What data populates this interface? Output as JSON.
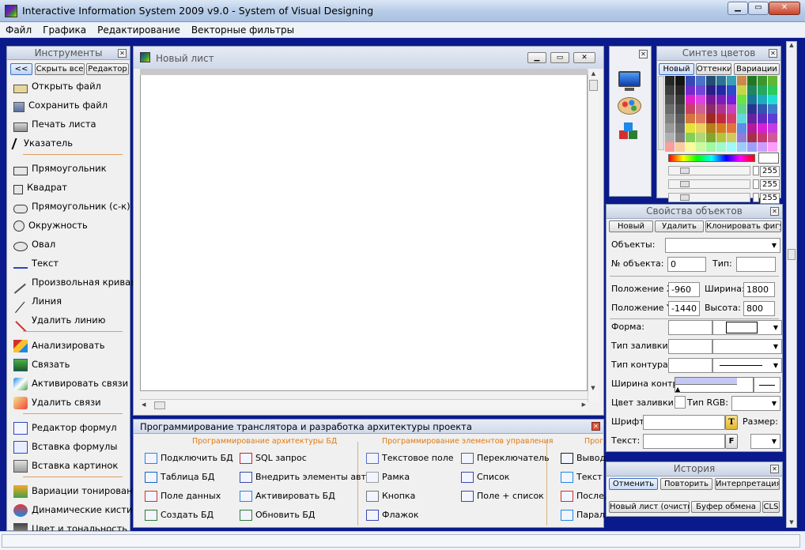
{
  "window": {
    "title": "Interactive Information System 2009 v9.0 - System of Visual Designing"
  },
  "menu": [
    "Файл",
    "Графика",
    "Редактирование",
    "Векторные фильтры"
  ],
  "tools": {
    "title": "Инструменты",
    "collapse_label": "<<",
    "hide_all_label": "Скрыть все",
    "editor_label": "Редактор",
    "items": [
      "Открыть файл",
      "Сохранить файл",
      "Печать листа",
      "Указатель",
      "Прямоугольник",
      "Квадрат",
      "Прямоугольник (с-к)",
      "Окружность",
      "Овал",
      "Текст",
      "Произвольная кривая",
      "Линия",
      "Удалить линию",
      "Анализировать",
      "Связать",
      "Активировать связи",
      "Удалить связи",
      "Редактор формул",
      "Вставка формулы",
      "Вставка картинок",
      "Вариации тонирования",
      "Динамические кисти",
      "Цвет и тональность"
    ],
    "icons": [
      "open-folder-icon",
      "save-icon",
      "print-icon",
      "pointer-icon",
      "rectangle-icon",
      "square-icon",
      "rounded-rectangle-icon",
      "circle-icon",
      "oval-icon",
      "text-icon",
      "freehand-curve-icon",
      "line-icon",
      "delete-line-icon",
      "analyze-icon",
      "link-icon",
      "activate-links-icon",
      "delete-links-icon",
      "formula-editor-icon",
      "insert-formula-icon",
      "insert-picture-icon",
      "tone-variations-icon",
      "dynamic-brushes-icon",
      "color-tone-icon"
    ]
  },
  "canvas": {
    "title": "Новый лист"
  },
  "bottom_panel": {
    "title": "Программирование транслятора и разработка архитектуры проекта",
    "group1": "Программирование архитектуры БД",
    "group2": "Программирование элементов управления",
    "group3": "Прог",
    "col1": [
      "Подключить БД",
      "Таблица БД",
      "Поле данных",
      "Создать БД"
    ],
    "col2": [
      "SQL запрос",
      "Внедрить элементы авт.",
      "Активировать БД",
      "Обновить БД"
    ],
    "col3": [
      "Текстовое поле",
      "Рамка",
      "Кнопка",
      "Флажок"
    ],
    "col4": [
      "Переключатель",
      "Список",
      "Поле + список"
    ],
    "col5": [
      "Вывод",
      "Текст л",
      "Послед",
      "Парал"
    ]
  },
  "color_synth": {
    "title": "Синтез цветов",
    "tabs": [
      "Новый",
      "Оттенки",
      "Вариации"
    ],
    "rgb_values": [
      "255",
      "255",
      "255"
    ]
  },
  "properties": {
    "title": "Свойства объектов",
    "new_label": "Новый",
    "delete_label": "Удалить",
    "clone_label": "Клонировать фигуру",
    "objects_label": "Объекты:",
    "obj_num_label": "№ объекта:",
    "obj_num_value": "0",
    "type_label": "Тип:",
    "posx_label": "Положение X:",
    "posx_value": "-960",
    "width_label": "Ширина:",
    "width_value": "1800",
    "posy_label": "Положение Y:",
    "posy_value": "-1440",
    "height_label": "Высота:",
    "height_value": "800",
    "shape_label": "Форма:",
    "fill_label": "Тип заливки:",
    "outline_label": "Тип контура:",
    "outline_width_label": "Ширина контр:",
    "fill_color_label": "Цвет заливки:",
    "rgb_type_label": "Тип RGB:",
    "font_label": "Шрифт:",
    "size_label": "Размер:",
    "text_label": "Текст:",
    "font_btn": "T",
    "fontf_btn": "F"
  },
  "history": {
    "title": "История",
    "undo_label": "Отменить",
    "redo_label": "Повторить",
    "interp_label": "Интерпретация",
    "new_sheet_label": "Новый лист (очистить)",
    "clipboard_label": "Буфер обмена",
    "cls_label": "CLS"
  },
  "colors": {
    "title_bar": "#c2d3ea",
    "desktop_blue": "#0a1a8c",
    "group_orange": "#e07a10"
  }
}
